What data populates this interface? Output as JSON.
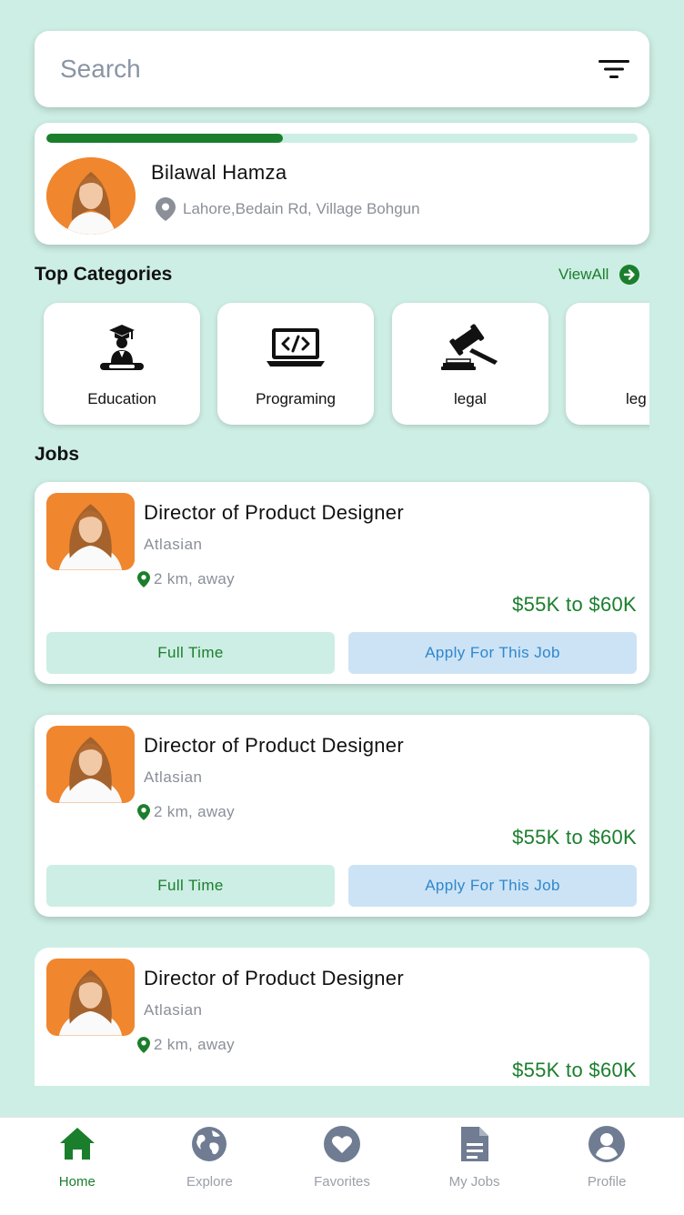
{
  "colors": {
    "background": "#cdeee4",
    "accent_green": "#1b7e2d",
    "apply_blue": "#2f87cc",
    "apply_bg": "#cce3f6",
    "muted": "#8a8f98",
    "avatar_orange": "#f0862e"
  },
  "search": {
    "placeholder": "Search",
    "filter_icon": "filter-icon"
  },
  "profile": {
    "name": "Bilawal Hamza",
    "location": "Lahore,Bedain Rd, Village Bohgun",
    "profile_completion": 0.4
  },
  "categories": {
    "title": "Top Categories",
    "view_all": "ViewAll",
    "items": [
      {
        "label": "Education",
        "icon": "graduate-icon"
      },
      {
        "label": "Programing",
        "icon": "code-laptop-icon"
      },
      {
        "label": "legal",
        "icon": "gavel-icon"
      },
      {
        "label": "leg",
        "icon": "document-chart-icon"
      }
    ]
  },
  "jobs": {
    "title": "Jobs",
    "items": [
      {
        "title": "Director of Product Designer",
        "company": "Atlasian",
        "distance": "2 km, away",
        "salary": "$55K to $60K",
        "type": "Full Time",
        "apply": "Apply For This Job"
      },
      {
        "title": "Director of Product Designer",
        "company": "Atlasian",
        "distance": "2 km, away",
        "salary": "$55K to $60K",
        "type": "Full Time",
        "apply": "Apply For This Job"
      },
      {
        "title": "Director of Product Designer",
        "company": "Atlasian",
        "distance": "2 km, away",
        "salary": "$55K to $60K"
      }
    ]
  },
  "nav": {
    "items": [
      {
        "label": "Home",
        "icon": "home-icon",
        "active": true
      },
      {
        "label": "Explore",
        "icon": "globe-icon",
        "active": false
      },
      {
        "label": "Favorites",
        "icon": "heart-icon",
        "active": false
      },
      {
        "label": "My Jobs",
        "icon": "document-icon",
        "active": false
      },
      {
        "label": "Profile",
        "icon": "person-icon",
        "active": false
      }
    ]
  }
}
